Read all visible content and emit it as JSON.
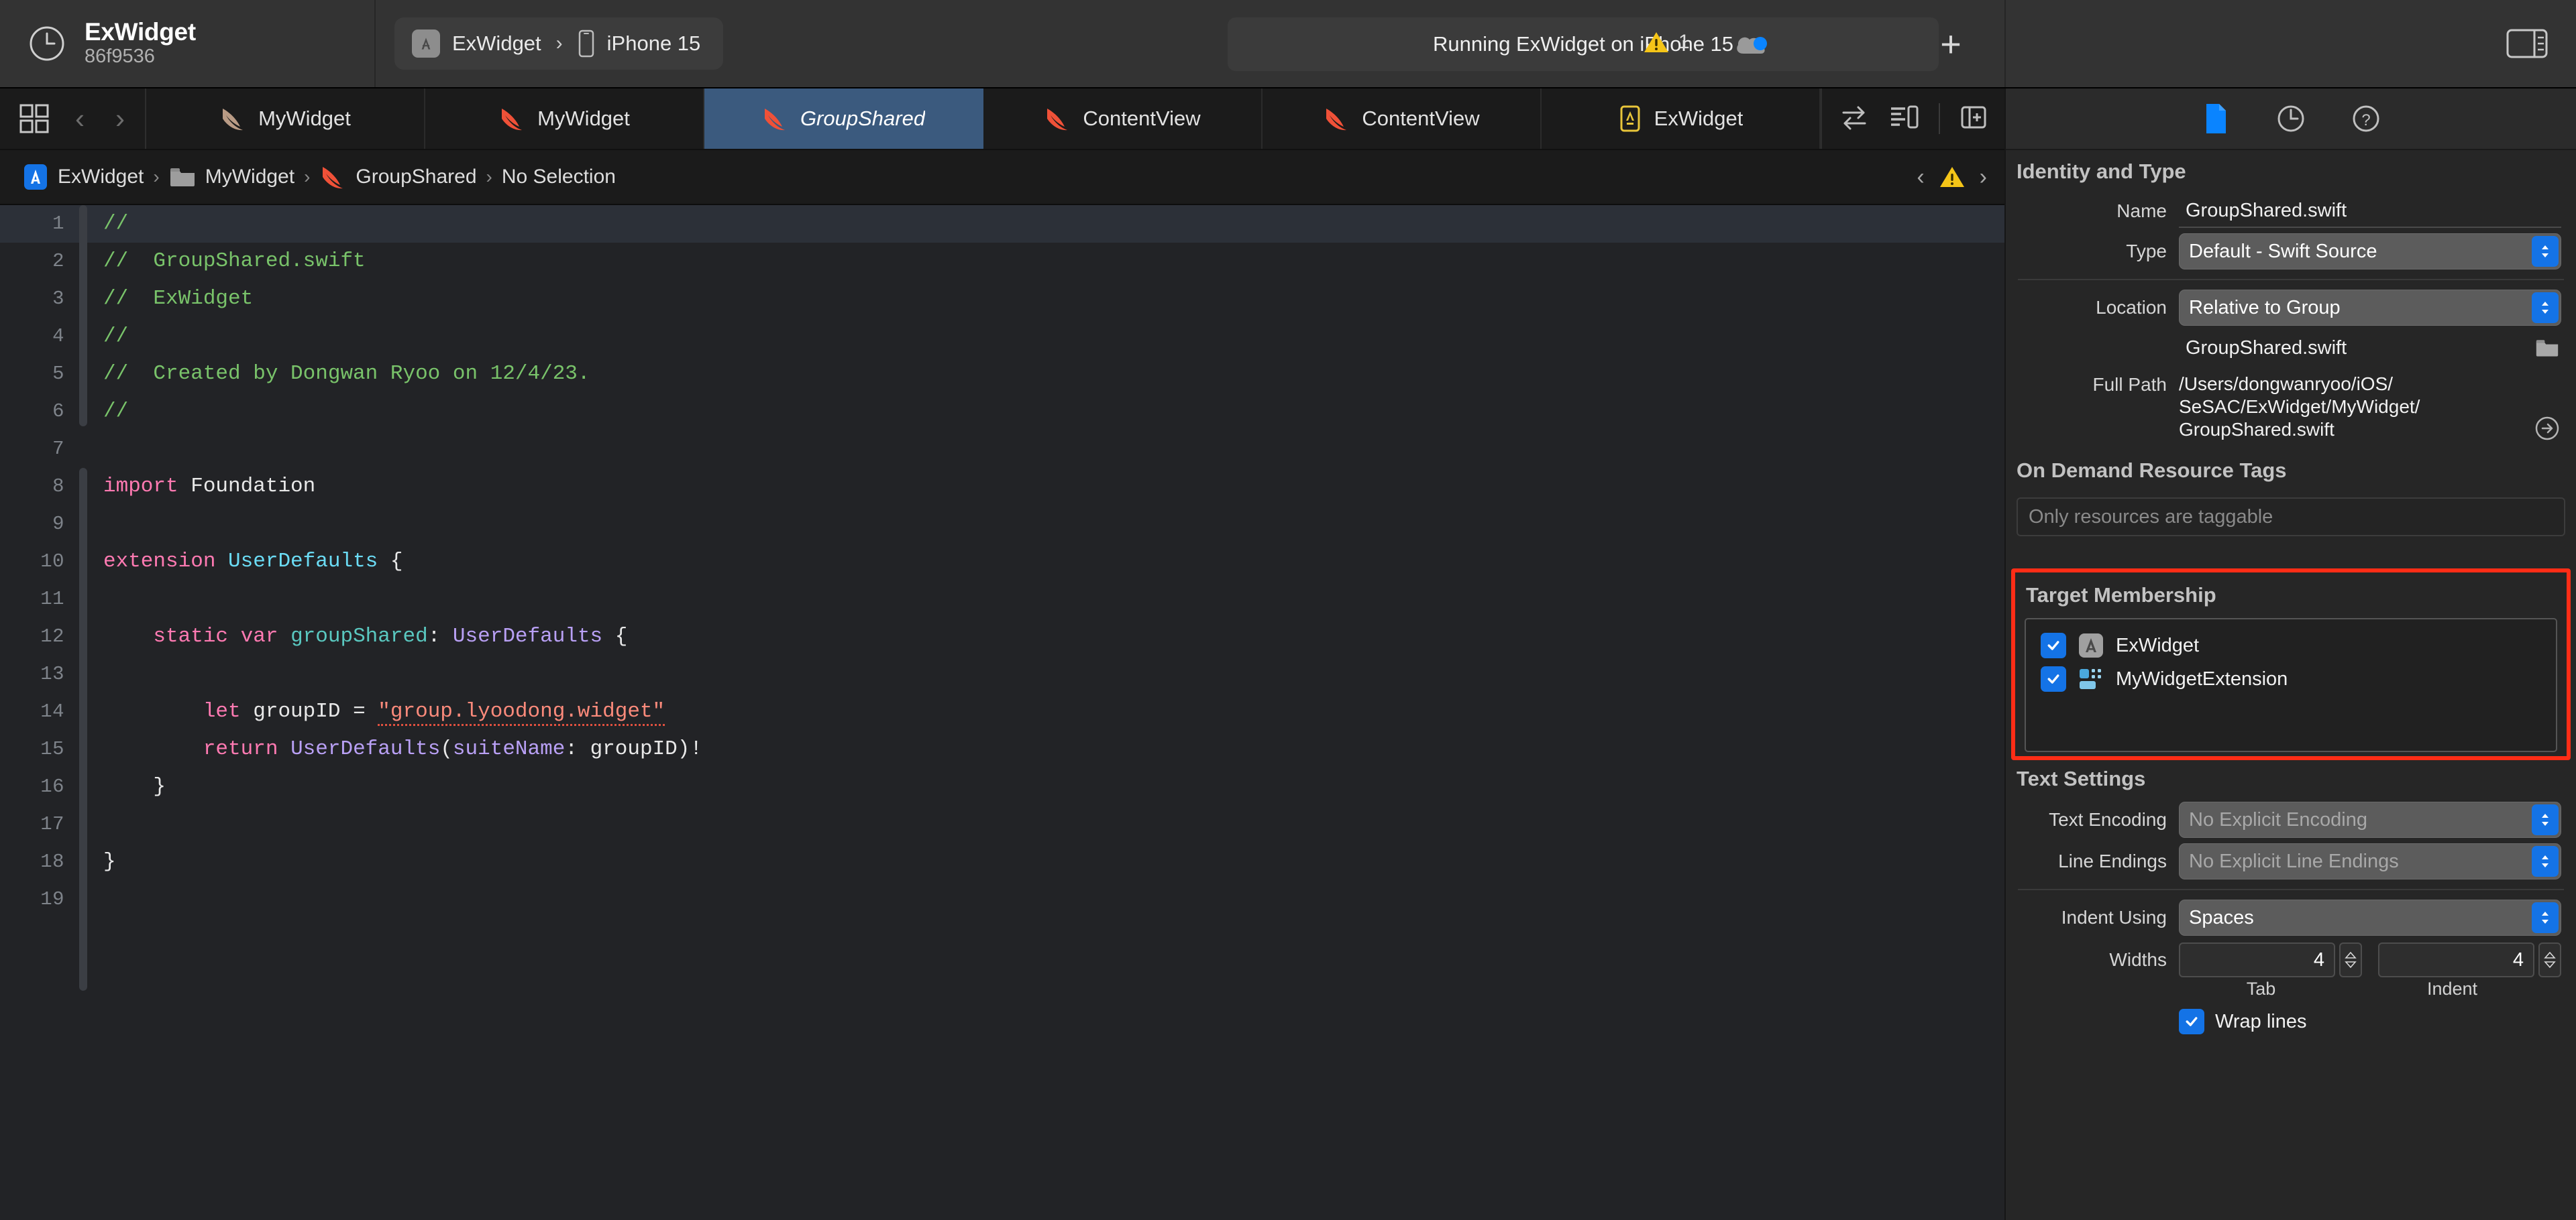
{
  "toolbar": {
    "project_name": "ExWidget",
    "project_hash": "86f9536",
    "clock_icon": "clock-icon",
    "scheme_name": "ExWidget",
    "scheme_separator": "›",
    "destination": "iPhone 15",
    "status_text": "Running ExWidget on iPhone 15",
    "warning_icon": "warning-triangle-icon",
    "warning_count": "1",
    "cloud_icon": "cloud-status-icon",
    "add_label": "+",
    "panel_toggle_icon": "inspector-panel-toggle-icon"
  },
  "tabbar": {
    "grid_icon": "editor-grid-icon",
    "back_icon": "‹",
    "forward_icon": "›",
    "tabs": [
      {
        "label": "MyWidget",
        "icon": "swift-file-icon-dim",
        "active": false
      },
      {
        "label": "MyWidget",
        "icon": "swift-file-icon",
        "active": false
      },
      {
        "label": "GroupShared",
        "icon": "swift-file-icon",
        "active": true
      },
      {
        "label": "ContentView",
        "icon": "swift-file-icon",
        "active": false
      },
      {
        "label": "ContentView",
        "icon": "swift-file-icon",
        "active": false
      },
      {
        "label": "ExWidget",
        "icon": "widgetkit-file-icon",
        "active": false
      }
    ],
    "right_icons": [
      "code-review-swap-icon",
      "minimap-icon",
      "add-editor-icon"
    ]
  },
  "jumpbar": {
    "crumbs": [
      {
        "label": "ExWidget",
        "icon": "xcode-project-icon"
      },
      {
        "label": "MyWidget",
        "icon": "folder-icon"
      },
      {
        "label": "GroupShared",
        "icon": "swift-file-icon"
      },
      {
        "label": "No Selection",
        "icon": ""
      }
    ],
    "separator": "›",
    "prev_issue_icon": "‹",
    "issue_icon": "warning-triangle-icon",
    "next_issue_icon": "›"
  },
  "editor": {
    "current_line": 1,
    "lines": [
      {
        "n": "1",
        "tokens": [
          {
            "t": "//",
            "c": "c-comment"
          }
        ]
      },
      {
        "n": "2",
        "tokens": [
          {
            "t": "//  GroupShared.swift",
            "c": "c-comment"
          }
        ]
      },
      {
        "n": "3",
        "tokens": [
          {
            "t": "//  ExWidget",
            "c": "c-comment"
          }
        ]
      },
      {
        "n": "4",
        "tokens": [
          {
            "t": "//",
            "c": "c-comment"
          }
        ]
      },
      {
        "n": "5",
        "tokens": [
          {
            "t": "//  Created by Dongwan Ryoo on 12/4/23.",
            "c": "c-comment"
          }
        ]
      },
      {
        "n": "6",
        "tokens": [
          {
            "t": "//",
            "c": "c-comment"
          }
        ]
      },
      {
        "n": "7",
        "tokens": []
      },
      {
        "n": "8",
        "tokens": [
          {
            "t": "import",
            "c": "c-kw"
          },
          {
            "t": " Foundation",
            "c": "c-plain"
          }
        ]
      },
      {
        "n": "9",
        "tokens": []
      },
      {
        "n": "10",
        "tokens": [
          {
            "t": "extension",
            "c": "c-kw"
          },
          {
            "t": " ",
            "c": "c-plain"
          },
          {
            "t": "UserDefaults",
            "c": "c-type"
          },
          {
            "t": " {",
            "c": "c-plain"
          }
        ]
      },
      {
        "n": "11",
        "tokens": []
      },
      {
        "n": "12",
        "tokens": [
          {
            "t": "    ",
            "c": "c-plain"
          },
          {
            "t": "static var",
            "c": "c-kw"
          },
          {
            "t": " ",
            "c": "c-plain"
          },
          {
            "t": "groupShared",
            "c": "c-prop"
          },
          {
            "t": ": ",
            "c": "c-plain"
          },
          {
            "t": "UserDefaults",
            "c": "c-type2"
          },
          {
            "t": " {",
            "c": "c-plain"
          }
        ]
      },
      {
        "n": "13",
        "tokens": []
      },
      {
        "n": "14",
        "tokens": [
          {
            "t": "        ",
            "c": "c-plain"
          },
          {
            "t": "let",
            "c": "c-kw"
          },
          {
            "t": " groupID = ",
            "c": "c-plain"
          },
          {
            "t": "\"group.lyoodong.widget\"",
            "c": "c-str misspell"
          }
        ]
      },
      {
        "n": "15",
        "tokens": [
          {
            "t": "        ",
            "c": "c-plain"
          },
          {
            "t": "return",
            "c": "c-kw"
          },
          {
            "t": " ",
            "c": "c-plain"
          },
          {
            "t": "UserDefaults",
            "c": "c-type2"
          },
          {
            "t": "(",
            "c": "c-plain"
          },
          {
            "t": "suiteName",
            "c": "c-type2"
          },
          {
            "t": ": groupID)!",
            "c": "c-plain"
          }
        ]
      },
      {
        "n": "16",
        "tokens": [
          {
            "t": "    }",
            "c": "c-plain"
          }
        ]
      },
      {
        "n": "17",
        "tokens": []
      },
      {
        "n": "18",
        "tokens": [
          {
            "t": "}",
            "c": "c-plain"
          }
        ]
      },
      {
        "n": "19",
        "tokens": []
      }
    ]
  },
  "inspector": {
    "tab_icons": [
      "file-inspector-icon",
      "history-inspector-icon",
      "quick-help-inspector-icon"
    ],
    "active_tab_index": 0,
    "identity": {
      "title": "Identity and Type",
      "name_label": "Name",
      "name_value": "GroupShared.swift",
      "type_label": "Type",
      "type_value": "Default - Swift Source",
      "location_label": "Location",
      "location_value": "Relative to Group",
      "location_file": "GroupShared.swift",
      "folder_icon": "folder-icon",
      "fullpath_label": "Full Path",
      "fullpath_lines": [
        "/Users/dongwanryoo/iOS/",
        "SeSAC/ExWidget/MyWidget/",
        "GroupShared.swift"
      ],
      "reveal_icon": "reveal-in-finder-arrow-icon"
    },
    "odr": {
      "title": "On Demand Resource Tags",
      "placeholder": "Only resources are taggable"
    },
    "target_membership": {
      "title": "Target Membership",
      "highlight_color": "#ff2d16",
      "items": [
        {
          "label": "ExWidget",
          "checked": true,
          "icon": "app-target-icon"
        },
        {
          "label": "MyWidgetExtension",
          "checked": true,
          "icon": "widget-extension-target-icon"
        }
      ]
    },
    "text_settings": {
      "title": "Text Settings",
      "encoding_label": "Text Encoding",
      "encoding_value": "No Explicit Encoding",
      "line_endings_label": "Line Endings",
      "line_endings_value": "No Explicit Line Endings",
      "indent_using_label": "Indent Using",
      "indent_using_value": "Spaces",
      "widths_label": "Widths",
      "tab_width": "4",
      "indent_width": "4",
      "tab_sublabel": "Tab",
      "indent_sublabel": "Indent",
      "wrap_lines_label": "Wrap lines",
      "wrap_lines_checked": true
    }
  }
}
